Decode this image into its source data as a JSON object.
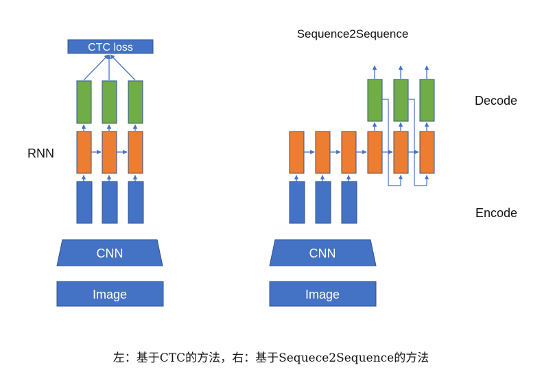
{
  "colors": {
    "blue": "#4472c4",
    "orange": "#ed7d31",
    "green": "#70ad47",
    "outline": "#2f528f",
    "arrow": "#4472c4",
    "text_dark": "#111111",
    "text_light": "#ffffff"
  },
  "left": {
    "loss_label": "CTC loss",
    "rnn_label": "RNN",
    "cnn_label": "CNN",
    "image_label": "Image"
  },
  "right": {
    "title": "Sequence2Sequence",
    "decode_label": "Decode",
    "encode_label": "Encode",
    "cnn_label": "CNN",
    "image_label": "Image"
  },
  "caption": "左：基于CTC的方法，右：基于Sequece2Sequence的方法"
}
